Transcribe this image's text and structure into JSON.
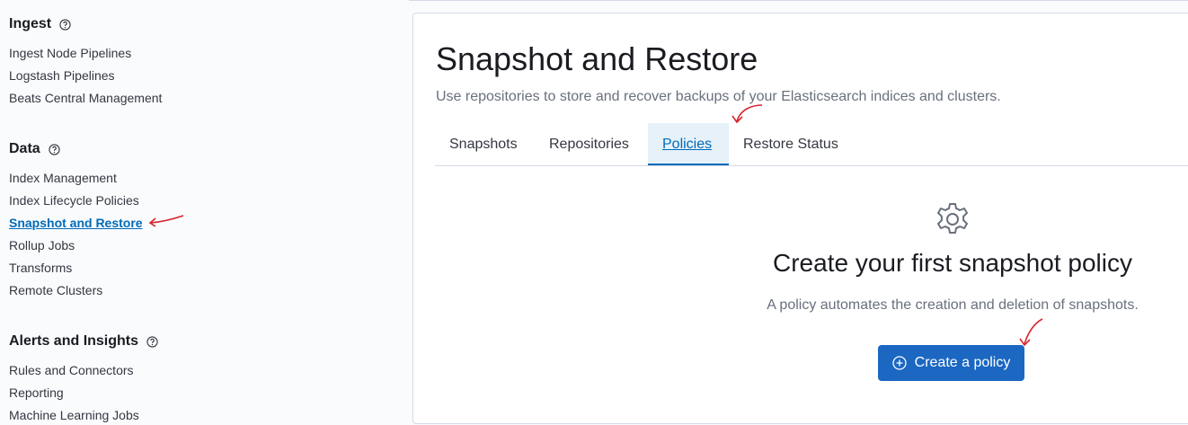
{
  "sidebar": {
    "sections": [
      {
        "title": "Ingest",
        "items": [
          "Ingest Node Pipelines",
          "Logstash Pipelines",
          "Beats Central Management"
        ]
      },
      {
        "title": "Data",
        "items": [
          "Index Management",
          "Index Lifecycle Policies",
          "Snapshot and Restore",
          "Rollup Jobs",
          "Transforms",
          "Remote Clusters"
        ]
      },
      {
        "title": "Alerts and Insights",
        "items": [
          "Rules and Connectors",
          "Reporting",
          "Machine Learning Jobs"
        ]
      }
    ],
    "active_item": "Snapshot and Restore"
  },
  "main": {
    "title": "Snapshot and Restore",
    "description": "Use repositories to store and recover backups of your Elasticsearch indices and clusters.",
    "tabs": [
      {
        "label": "Snapshots"
      },
      {
        "label": "Repositories"
      },
      {
        "label": "Policies"
      },
      {
        "label": "Restore Status"
      }
    ],
    "active_tab": "Policies",
    "empty_state": {
      "icon": "gear-icon",
      "title": "Create your first snapshot policy",
      "body": "A policy automates the creation and deletion of snapshots.",
      "button_label": "Create a policy",
      "button_icon": "plus-circle-icon"
    }
  },
  "colors": {
    "accent": "#006bb8",
    "button": "#1b67c2",
    "annotation": "#d6232d"
  }
}
